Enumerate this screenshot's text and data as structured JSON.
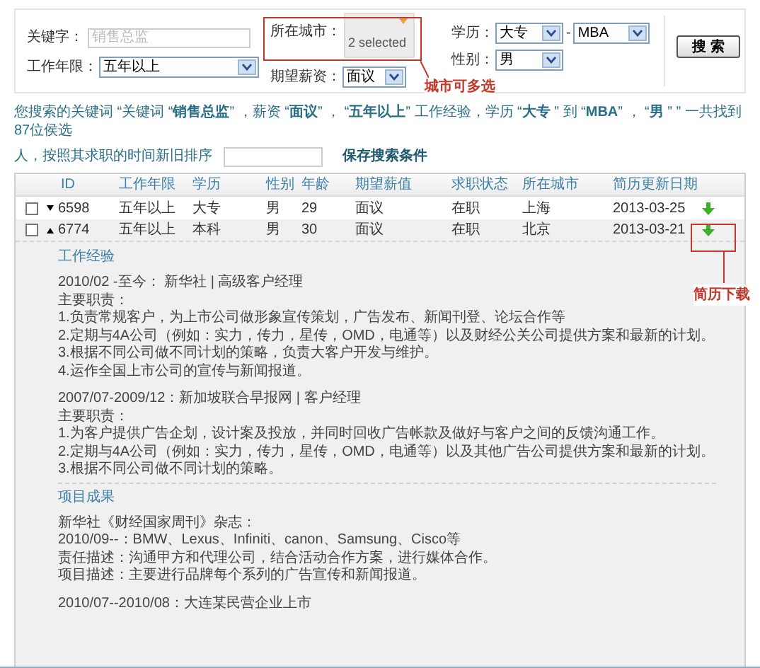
{
  "search_form": {
    "keyword": {
      "label": "关键字：",
      "placeholder": "销售总监"
    },
    "work_years": {
      "label": "工作年限：",
      "value": "五年以上"
    },
    "city": {
      "label": "所在城市：",
      "value": "2 selected"
    },
    "salary": {
      "label": "期望薪资：",
      "value": "面议"
    },
    "education": {
      "label": "学历：",
      "from": "大专",
      "separator": "-",
      "to": "MBA"
    },
    "gender": {
      "label": "性别：",
      "value": "男"
    },
    "search_button": "搜 索"
  },
  "annotations": [
    {
      "text": "城市可多选"
    },
    {
      "text": "简历下载"
    }
  ],
  "summary": "您搜索的关键词 “关键词 “**销售总监**” ，薪资 “**面议**” ， “**五年以上**” 工作经验，学历 “**大专** ” 到 “**MBA**” ， “**男** ” ” 一共找到 87位侯选",
  "sort_note": "人，按照其求职的时间新旧排序",
  "save_link": "保存搜索条件",
  "table": {
    "columns": [
      "ID",
      "工作年限",
      "学历",
      "性别",
      "年龄",
      "期望薪值",
      "求职状态",
      "所在城市",
      "简历更新日期"
    ],
    "rows": [
      {
        "checked": false,
        "expanded": false,
        "cells": [
          "6598",
          "五年以上",
          "大专",
          "男",
          "29",
          "面议",
          "在职",
          "上海",
          "2013-03-25"
        ]
      },
      {
        "checked": false,
        "expanded": true,
        "cells": [
          "6774",
          "五年以上",
          "本科",
          "男",
          "30",
          "面议",
          "在职",
          "北京",
          "2013-03-21"
        ]
      }
    ]
  },
  "detail": {
    "sections": [
      {
        "heading": "工作经验",
        "blocks": [
          [
            "2010/02 -至今： 新华社 | 高级客户经理",
            "主要职责：",
            "1.负责常规客户，为上市公司做形象宣传策划，广告发布、新闻刊登、论坛合作等",
            "2.定期与4A公司（例如：实力，传力，星传，OMD，电通等）以及财经公关公司提供方案和最新的计划。",
            "3.根据不同公司做不同计划的策略，负责大客户开发与维护。",
            "4.运作全国上市公司的宣传与新闻报道。"
          ],
          [
            "2007/07-2009/12：新加坡联合早报网 | 客户经理",
            "主要职责：",
            "1.为客户提供广告企划，设计案及投放，并同时回收广告帐款及做好与客户之间的反馈沟通工作。",
            "2.定期与4A公司（例如：实力，传力，星传，OMD，电通等）以及其他广告公司提供方案和最新的计划。",
            "3.根据不同公司做不同计划的策略。"
          ]
        ]
      },
      {
        "heading": "项目成果",
        "blocks": [
          [
            "新华社《财经国家周刊》杂志：",
            "2010/09--：BMW、Lexus、Infiniti、canon、Samsung、Cisco等",
            "责任描述：沟通甲方和代理公司，结合活动合作方案，进行媒体合作。",
            "项目描述：主要进行品牌每个系列的广告宣传和新闻报道。"
          ],
          [
            "2010/07--2010/08：大连某民营企业上市"
          ]
        ]
      }
    ]
  }
}
